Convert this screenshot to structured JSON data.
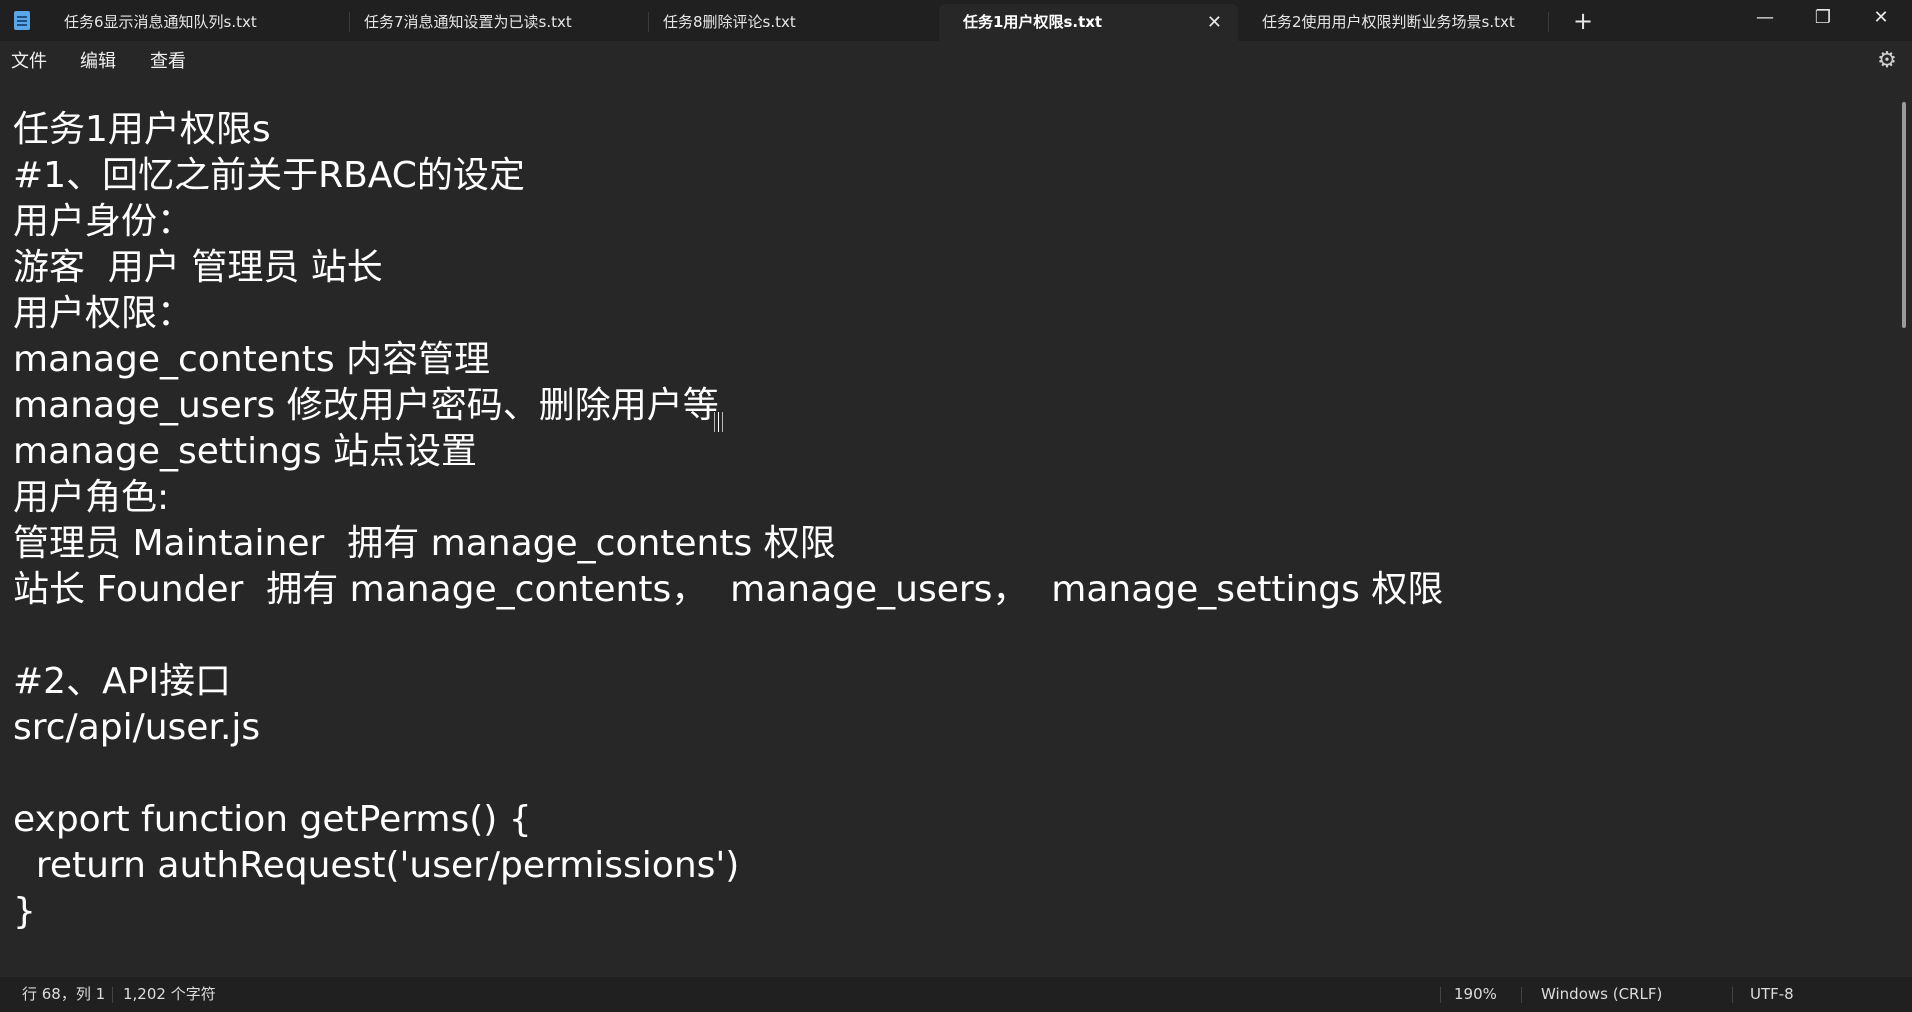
{
  "tabs": [
    {
      "label": "任务6显示消息通知队列s.txt",
      "active": false
    },
    {
      "label": "任务7消息通知设置为已读s.txt",
      "active": false
    },
    {
      "label": "任务8删除评论s.txt",
      "active": false
    },
    {
      "label": "任务1用户权限s.txt",
      "active": true
    },
    {
      "label": "任务2使用用户权限判断业务场景s.txt",
      "active": false
    }
  ],
  "tab_close_glyph": "✕",
  "new_tab_glyph": "+",
  "window_controls": {
    "minimize": "—",
    "restore": "❐",
    "close": "✕"
  },
  "menu": [
    "文件",
    "编辑",
    "查看"
  ],
  "settings_glyph": "⚙",
  "document_lines": [
    "任务1用户权限s",
    "#1、回忆之前关于RBAC的设定",
    "用户身份：",
    "游客  用户 管理员 站长",
    "用户权限：",
    "manage_contents 内容管理",
    "manage_users 修改用户密码、删除用户等",
    "manage_settings 站点设置",
    "用户角色:",
    "管理员 Maintainer  拥有 manage_contents 权限",
    "站长 Founder  拥有 manage_contents，  manage_users，  manage_settings 权限",
    "",
    "#2、API接口",
    "src/api/user.js",
    "",
    "export function getPerms() {",
    "  return authRequest('user/permissions')",
    "}"
  ],
  "status": {
    "position": "行 68，列 1",
    "char_count": "1,202 个字符",
    "zoom": "190%",
    "line_ending": "Windows (CRLF)",
    "encoding": "UTF-8"
  },
  "icons": {
    "app": "notepad-icon",
    "settings": "gear-icon"
  }
}
